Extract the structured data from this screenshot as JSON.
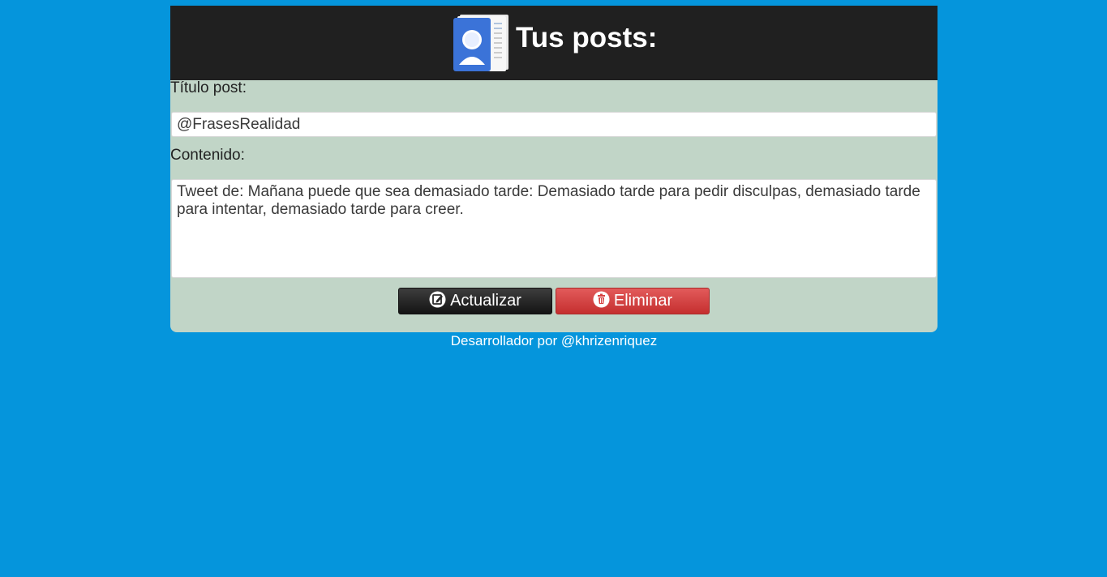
{
  "header": {
    "title": "Tus posts:",
    "icon": "contacts-app-icon"
  },
  "form": {
    "title_label": "Título post:",
    "title_value": "@FrasesRealidad",
    "content_label": "Contenido:",
    "content_value": "Tweet de: Mañana puede que sea demasiado tarde: Demasiado tarde para pedir disculpas, demasiado tarde para intentar, demasiado tarde para creer."
  },
  "actions": {
    "update_label": "Actualizar",
    "update_icon": "edit-icon",
    "delete_label": "Eliminar",
    "delete_icon": "trash-icon"
  },
  "footer": {
    "text": "Desarrollador por @khrizenriquez"
  },
  "colors": {
    "background": "#0595dc",
    "header": "#202020",
    "panel": "#c1d5c7",
    "update_button": "#2a2a2a",
    "delete_button": "#d74242"
  }
}
